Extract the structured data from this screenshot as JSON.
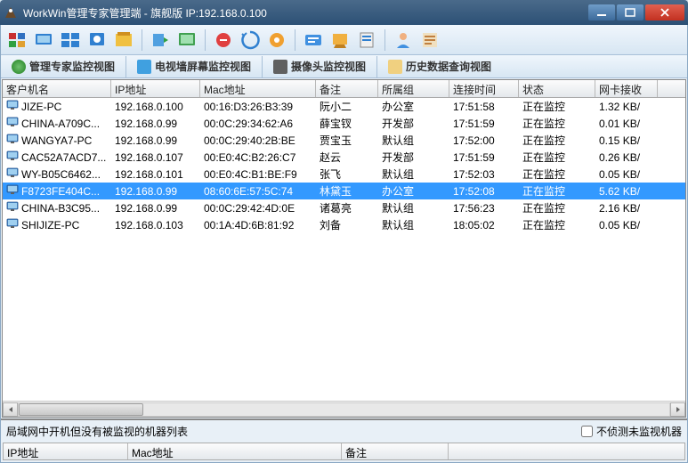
{
  "window": {
    "title": "WorkWin管理专家管理端 - 旗舰版 IP:192.168.0.100"
  },
  "tabs": {
    "t1": "管理专家监控视图",
    "t2": "电视墙屏幕监控视图",
    "t3": "摄像头监控视图",
    "t4": "历史数据查询视图"
  },
  "columns": {
    "c0": "客户机名",
    "c1": "IP地址",
    "c2": "Mac地址",
    "c3": "备注",
    "c4": "所属组",
    "c5": "连接时间",
    "c6": "状态",
    "c7": "网卡接收"
  },
  "rows": [
    {
      "name": "JIZE-PC",
      "ip": "192.168.0.100",
      "mac": "00:16:D3:26:B3:39",
      "note": "阮小二",
      "group": "办公室",
      "time": "17:51:58",
      "status": "正在监控",
      "rx": "1.32 KB/"
    },
    {
      "name": "CHINA-A709C...",
      "ip": "192.168.0.99",
      "mac": "00:0C:29:34:62:A6",
      "note": "薛宝钗",
      "group": "开发部",
      "time": "17:51:59",
      "status": "正在监控",
      "rx": "0.01 KB/"
    },
    {
      "name": "WANGYA7-PC",
      "ip": "192.168.0.99",
      "mac": "00:0C:29:40:2B:BE",
      "note": "贾宝玉",
      "group": "默认组",
      "time": "17:52:00",
      "status": "正在监控",
      "rx": "0.15 KB/"
    },
    {
      "name": "CAC52A7ACD7...",
      "ip": "192.168.0.107",
      "mac": "00:E0:4C:B2:26:C7",
      "note": "赵云",
      "group": "开发部",
      "time": "17:51:59",
      "status": "正在监控",
      "rx": "0.26 KB/"
    },
    {
      "name": "WY-B05C6462...",
      "ip": "192.168.0.101",
      "mac": "00:E0:4C:B1:BE:F9",
      "note": "张飞",
      "group": "默认组",
      "time": "17:52:03",
      "status": "正在监控",
      "rx": "0.05 KB/"
    },
    {
      "name": "F8723FE404C...",
      "ip": "192.168.0.99",
      "mac": "08:60:6E:57:5C:74",
      "note": "林黛玉",
      "group": "办公室",
      "time": "17:52:08",
      "status": "正在监控",
      "rx": "5.62 KB/",
      "selected": true
    },
    {
      "name": "CHINA-B3C95...",
      "ip": "192.168.0.99",
      "mac": "00:0C:29:42:4D:0E",
      "note": "诸葛亮",
      "group": "默认组",
      "time": "17:56:23",
      "status": "正在监控",
      "rx": "2.16 KB/"
    },
    {
      "name": "SHIJIZE-PC",
      "ip": "192.168.0.103",
      "mac": "00:1A:4D:6B:81:92",
      "note": "刘备",
      "group": "默认组",
      "time": "18:05:02",
      "status": "正在监控",
      "rx": "0.05 KB/"
    }
  ],
  "bottom": {
    "label": "局域网中开机但没有被监视的机器列表",
    "checkbox": "不侦测未监视机器",
    "h0": "IP地址",
    "h1": "Mac地址",
    "h2": "备注"
  }
}
